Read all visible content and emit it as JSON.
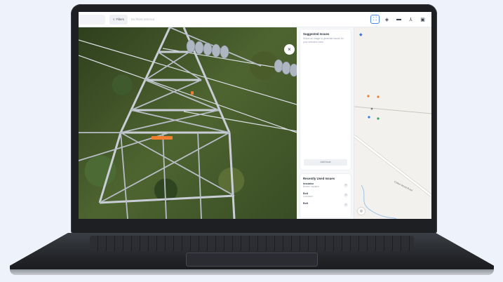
{
  "toolbar": {
    "filters_label": "Filters",
    "filters_icon": "filter-icon",
    "filter_hint": "No filters selected",
    "tools": [
      {
        "name": "grid-icon",
        "glyph": "⛶",
        "active": true
      },
      {
        "name": "layers-icon",
        "glyph": "◈",
        "active": false
      },
      {
        "name": "image-icon",
        "glyph": "▬",
        "active": false
      },
      {
        "name": "person-icon",
        "glyph": "⅄",
        "active": false
      },
      {
        "name": "gallery-icon",
        "glyph": "▣",
        "active": false
      }
    ]
  },
  "viewer": {
    "close_glyph": "×"
  },
  "suggested": {
    "title": "Suggested Issues",
    "description": "Select an image to generate issues for your selection area",
    "add_label": "Add Issue"
  },
  "recent": {
    "title": "Recently Used Issues",
    "items": [
      {
        "name": "Insulator",
        "sub": "Broken insulator",
        "action": "+"
      },
      {
        "name": "Bolt",
        "sub": "Corrosion",
        "action": "+"
      },
      {
        "name": "Bolt",
        "sub": "",
        "action": "+"
      }
    ]
  },
  "map": {
    "road_name": "Cotton Wood Road",
    "colors": {
      "marker_orange": "#ee7d2e",
      "marker_green": "#35a65a",
      "marker_blue": "#3c7be0"
    }
  },
  "colors": {
    "accent": "#3575db",
    "tag": "#ee7d2e"
  }
}
